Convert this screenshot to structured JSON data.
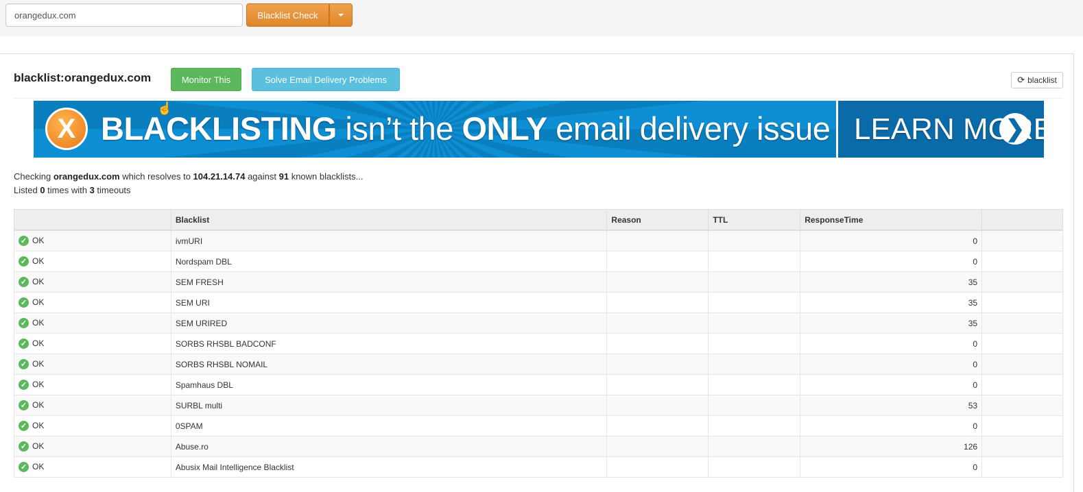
{
  "search": {
    "value": "orangedux.com"
  },
  "toolbar": {
    "check_label": "Blacklist Check"
  },
  "header": {
    "title": "blacklist:orangedux.com",
    "monitor_label": "Monitor This",
    "solve_label": "Solve Email Delivery Problems",
    "refresh_label": "blacklist"
  },
  "banner": {
    "badge": "X",
    "word1": "BLACKLISTING",
    "word2": " isn’t the ",
    "word3": "ONLY",
    "word4": " email delivery issue",
    "cta": "LEARN MORE",
    "arrow": "❯"
  },
  "summary": {
    "pre": "Checking ",
    "domain": "orangedux.com",
    "mid1": " which resolves to ",
    "ip": "104.21.14.74",
    "mid2": " against ",
    "count": "91",
    "post": " known blacklists...",
    "listed_pre": "Listed ",
    "listed": "0",
    "listed_mid": " times with ",
    "timeouts": "3",
    "listed_post": " timeouts"
  },
  "table": {
    "headers": [
      "",
      "Blacklist",
      "Reason",
      "TTL",
      "ResponseTime",
      ""
    ],
    "rows": [
      {
        "status": "OK",
        "name": "ivmURI",
        "time": "0"
      },
      {
        "status": "OK",
        "name": "Nordspam DBL",
        "time": "0"
      },
      {
        "status": "OK",
        "name": "SEM FRESH",
        "time": "35"
      },
      {
        "status": "OK",
        "name": "SEM URI",
        "time": "35"
      },
      {
        "status": "OK",
        "name": "SEM URIRED",
        "time": "35"
      },
      {
        "status": "OK",
        "name": "SORBS RHSBL BADCONF",
        "time": "0"
      },
      {
        "status": "OK",
        "name": "SORBS RHSBL NOMAIL",
        "time": "0"
      },
      {
        "status": "OK",
        "name": "Spamhaus DBL",
        "time": "0"
      },
      {
        "status": "OK",
        "name": "SURBL multi",
        "time": "53"
      },
      {
        "status": "OK",
        "name": "0SPAM",
        "time": "0"
      },
      {
        "status": "OK",
        "name": "Abuse.ro",
        "time": "126"
      },
      {
        "status": "OK",
        "name": "Abusix Mail Intelligence Blacklist",
        "time": "0"
      }
    ]
  },
  "colors": {
    "accent_orange": "#e0862d",
    "success": "#5cb85c",
    "info": "#5bc0de",
    "banner_blue": "#0a83c6"
  }
}
